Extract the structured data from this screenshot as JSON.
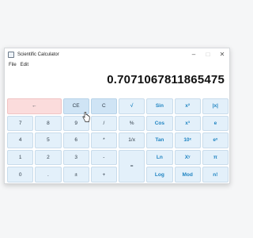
{
  "window": {
    "title": "Scientific Calculator",
    "controls": {
      "minimize": "–",
      "maximize": "□",
      "close": "✕"
    }
  },
  "menu": {
    "file": "File",
    "edit": "Edit"
  },
  "display": {
    "value": "0.7071067811865475"
  },
  "keys": {
    "backspace": "←",
    "ce": "CE",
    "c": "C",
    "sqrt": "√",
    "sin": "Sin",
    "x2": "x²",
    "abs": "|x|",
    "d7": "7",
    "d8": "8",
    "d9": "9",
    "divide": "/",
    "percent": "%",
    "cos": "Cos",
    "x3": "x³",
    "e": "e",
    "d4": "4",
    "d5": "5",
    "d6": "6",
    "multiply": "*",
    "reciprocal": "1/x",
    "tan": "Tan",
    "ten_pow": "10ˣ",
    "e_pow": "eˣ",
    "d1": "1",
    "d2": "2",
    "d3": "3",
    "minus": "-",
    "equals": "=",
    "ln": "Ln",
    "x_pow_y": "Xʸ",
    "pi": "π",
    "d0": "0",
    "dot": ".",
    "plus_minus": "±",
    "plus": "+",
    "log": "Log",
    "mod": "Mod",
    "factorial": "n!"
  },
  "colors": {
    "key_bg": "#e3f0fa",
    "backspace_bg": "#fbdcdc",
    "function_text": "#1f84c2"
  },
  "icons": {
    "app": "calculator-icon",
    "cursor": "hand-pointer-icon"
  }
}
